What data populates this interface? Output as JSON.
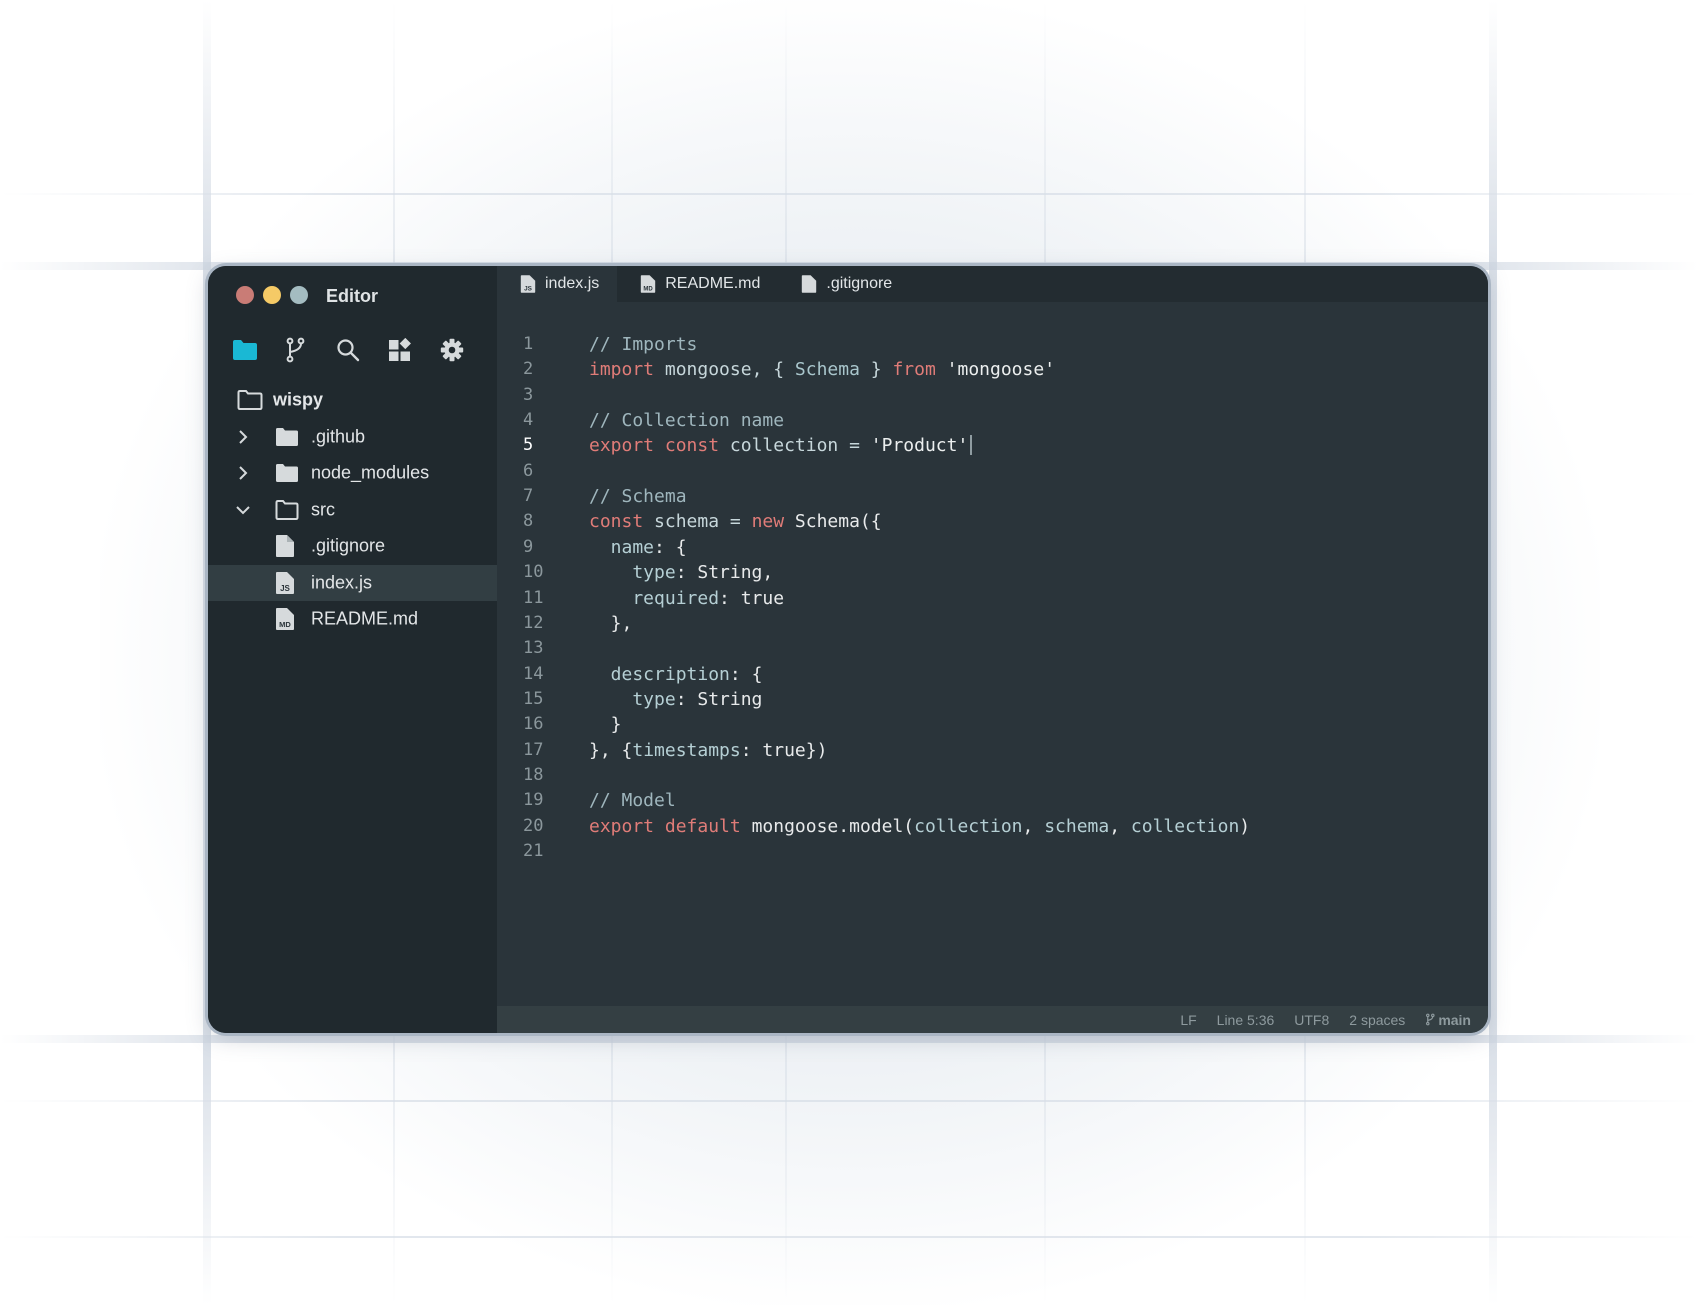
{
  "window": {
    "title": "Editor",
    "traffic_lights": [
      {
        "name": "close",
        "color": "#c97c76"
      },
      {
        "name": "minimize",
        "color": "#f5ca66"
      },
      {
        "name": "zoom",
        "color": "#a4bcc1"
      }
    ]
  },
  "toolbar": {
    "items": [
      {
        "icon": "folder-icon",
        "label": "Explorer",
        "active": true,
        "color": "#1ab8d4"
      },
      {
        "icon": "git-branch-icon",
        "label": "Source Control",
        "active": false
      },
      {
        "icon": "search-icon",
        "label": "Search",
        "active": false
      },
      {
        "icon": "extensions-icon",
        "label": "Extensions",
        "active": false
      },
      {
        "icon": "gear-icon",
        "label": "Settings",
        "active": false
      }
    ]
  },
  "explorer": {
    "root": "wispy",
    "items": [
      {
        "label": ".github",
        "type": "folder",
        "expanded": false,
        "depth": 0
      },
      {
        "label": "node_modules",
        "type": "folder",
        "expanded": false,
        "depth": 0
      },
      {
        "label": "src",
        "type": "folder",
        "expanded": true,
        "depth": 0
      },
      {
        "label": ".gitignore",
        "type": "file",
        "icon": "file-icon",
        "depth": 1
      },
      {
        "label": "index.js",
        "type": "file",
        "icon": "js-file-icon",
        "badge": "JS",
        "depth": 1,
        "selected": true
      },
      {
        "label": "README.md",
        "type": "file",
        "icon": "md-file-icon",
        "badge": "MD",
        "depth": 1
      }
    ]
  },
  "tabs": [
    {
      "label": "index.js",
      "icon": "js-file-icon",
      "badge": "JS",
      "active": true
    },
    {
      "label": "README.md",
      "icon": "md-file-icon",
      "badge": "MD",
      "active": false
    },
    {
      "label": ".gitignore",
      "icon": "file-icon",
      "active": false
    }
  ],
  "editor": {
    "active_line": 5,
    "lines": [
      {
        "n": "1",
        "tokens": [
          [
            "cm",
            "// Imports"
          ]
        ]
      },
      {
        "n": "2",
        "tokens": [
          [
            "kw",
            "import"
          ],
          [
            "id",
            " mongoose, { "
          ],
          [
            "ty",
            "Schema"
          ],
          [
            "id",
            " } "
          ],
          [
            "kw",
            "from"
          ],
          [
            "st",
            " 'mongoose'"
          ]
        ]
      },
      {
        "n": "3",
        "tokens": []
      },
      {
        "n": "4",
        "tokens": [
          [
            "cm",
            "// Collection name"
          ]
        ]
      },
      {
        "n": "5",
        "tokens": [
          [
            "kw",
            "export"
          ],
          [
            "id",
            " "
          ],
          [
            "kw",
            "const"
          ],
          [
            "id",
            " collection = "
          ],
          [
            "st",
            "'Product'"
          ]
        ],
        "cursor": true
      },
      {
        "n": "6",
        "tokens": []
      },
      {
        "n": "7",
        "tokens": [
          [
            "cm",
            "// Schema"
          ]
        ]
      },
      {
        "n": "8",
        "tokens": [
          [
            "kw",
            "const"
          ],
          [
            "id",
            " schema = "
          ],
          [
            "kw",
            "new"
          ],
          [
            "pl",
            " Schema({"
          ]
        ]
      },
      {
        "n": "9",
        "tokens": [
          [
            "pr",
            "  name"
          ],
          [
            "pl",
            ": {"
          ]
        ]
      },
      {
        "n": "10",
        "tokens": [
          [
            "pr",
            "    type"
          ],
          [
            "pl",
            ": String,"
          ]
        ]
      },
      {
        "n": "11",
        "tokens": [
          [
            "pr",
            "    required"
          ],
          [
            "pl",
            ": true"
          ]
        ]
      },
      {
        "n": "12",
        "tokens": [
          [
            "pl",
            "  },"
          ]
        ]
      },
      {
        "n": "13",
        "tokens": []
      },
      {
        "n": "14",
        "tokens": [
          [
            "pr",
            "  description"
          ],
          [
            "pl",
            ": {"
          ]
        ]
      },
      {
        "n": "15",
        "tokens": [
          [
            "pr",
            "    type"
          ],
          [
            "pl",
            ": String"
          ]
        ]
      },
      {
        "n": "16",
        "tokens": [
          [
            "pl",
            "  }"
          ]
        ]
      },
      {
        "n": "17",
        "tokens": [
          [
            "pl",
            "}, {"
          ],
          [
            "pr",
            "timestamps"
          ],
          [
            "pl",
            ": true})"
          ]
        ]
      },
      {
        "n": "18",
        "tokens": []
      },
      {
        "n": "19",
        "tokens": [
          [
            "cm",
            "// Model"
          ]
        ]
      },
      {
        "n": "20",
        "tokens": [
          [
            "kw",
            "export"
          ],
          [
            "id",
            " "
          ],
          [
            "kw",
            "default"
          ],
          [
            "pl",
            " mongoose.model("
          ],
          [
            "pr",
            "collection"
          ],
          [
            "pl",
            ", "
          ],
          [
            "pr",
            "schema"
          ],
          [
            "pl",
            ", "
          ],
          [
            "pr",
            "collection"
          ],
          [
            "pl",
            ")"
          ]
        ]
      },
      {
        "n": "21",
        "tokens": []
      }
    ]
  },
  "statusbar": {
    "line_ending": "LF",
    "position": "Line 5:36",
    "encoding": "UTF8",
    "indent": "2 spaces",
    "branch": "main",
    "branch_icon": "git-branch-icon"
  }
}
